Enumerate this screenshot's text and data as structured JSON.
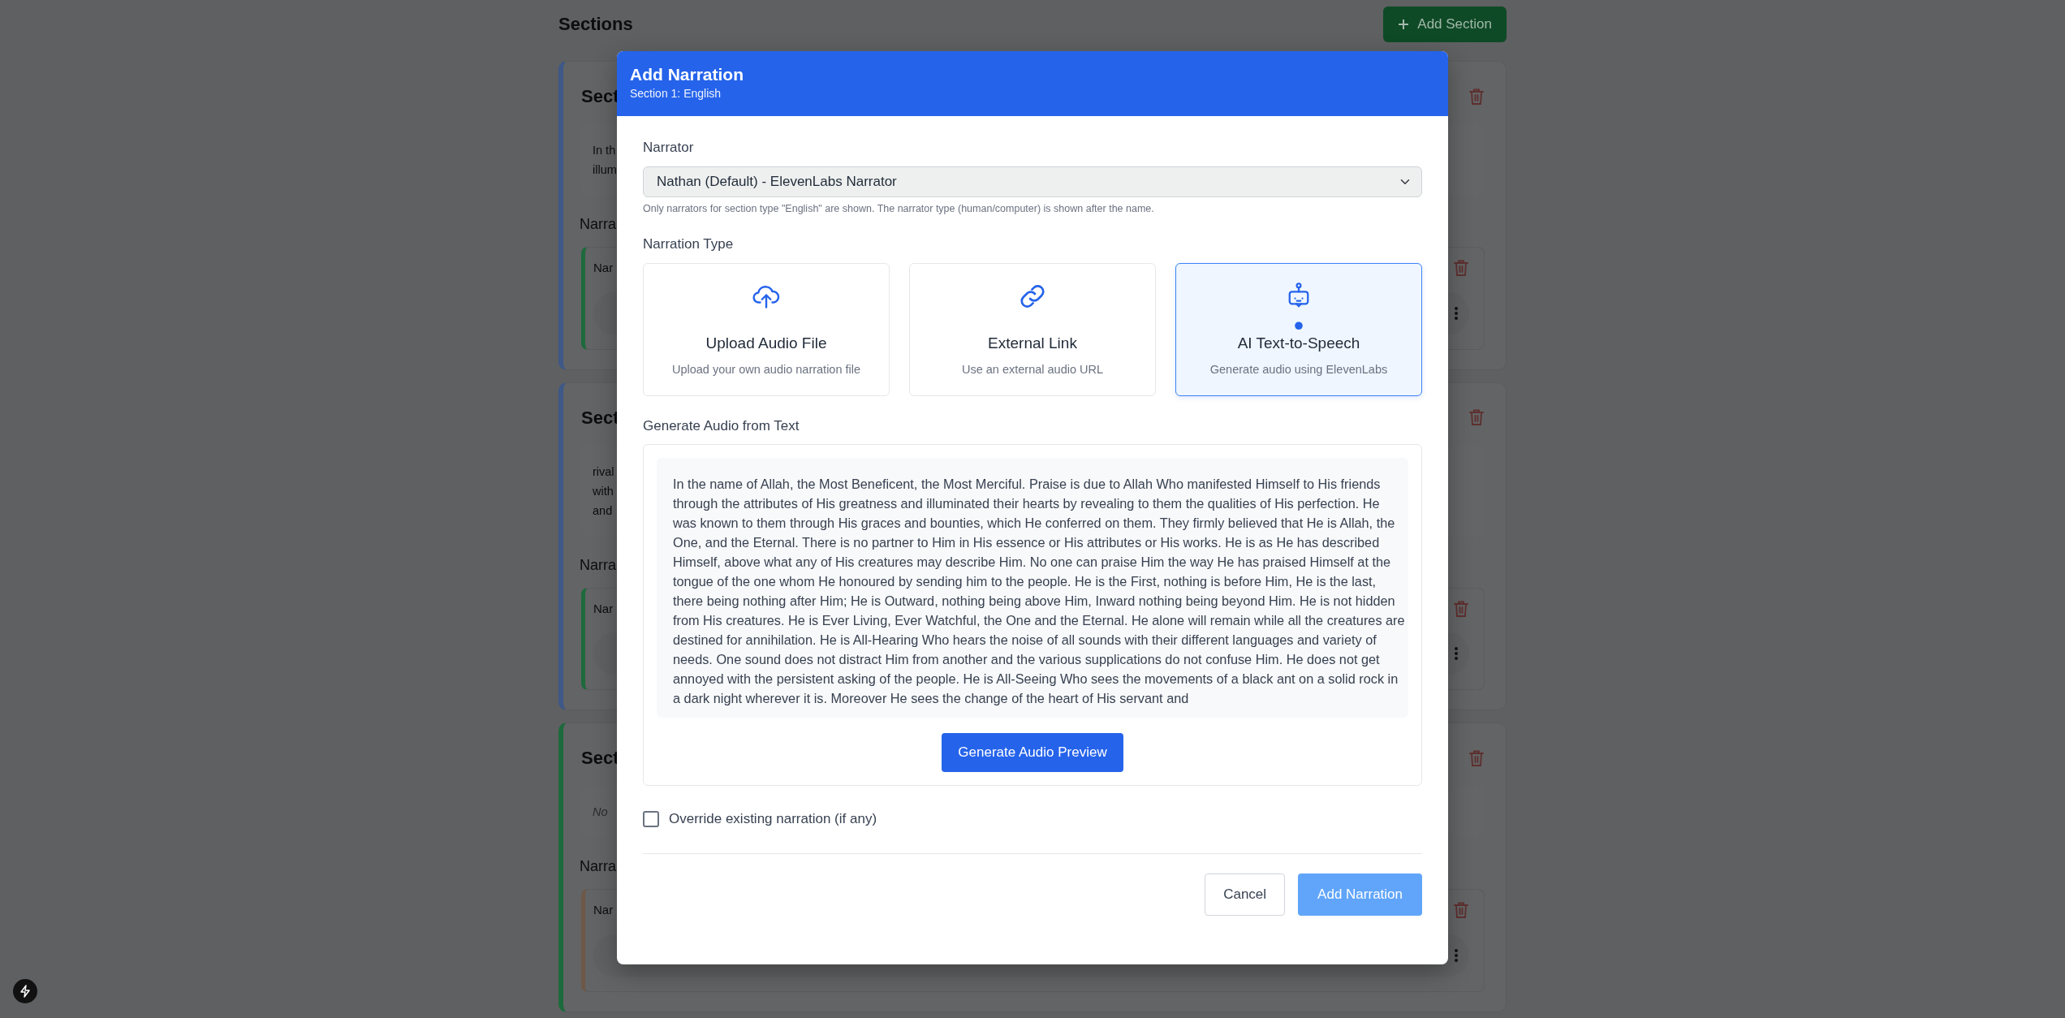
{
  "page": {
    "title": "Sections",
    "add_button": "Add Section"
  },
  "sections": [
    {
      "title": "Sect",
      "color": "#3e5887",
      "description": {
        "kind": "text",
        "lines": [
          "In th",
          "illum"
        ]
      },
      "narrations_label": "Narra",
      "narration": {
        "label": "Nar",
        "color": "#1d6a3c"
      }
    },
    {
      "title": "Sect",
      "color": "#3e5887",
      "description": {
        "kind": "text",
        "lines": [
          "rival",
          "with",
          "and"
        ]
      },
      "narrations_label": "Narra",
      "narration": {
        "label": "Nar",
        "color": "#1d6a3c"
      }
    },
    {
      "title": "Sect",
      "color": "#1d6a3c",
      "description": {
        "kind": "empty",
        "lines": [
          "No"
        ]
      },
      "narrations_label": "Narra",
      "narration": {
        "label": "Nar",
        "color": "#6e5848"
      }
    }
  ],
  "modal": {
    "title": "Add Narration",
    "subtitle": "Section 1: English",
    "narrator": {
      "label": "Narrator",
      "value": "Nathan (Default) - ElevenLabs Narrator",
      "help": "Only narrators for section type \"English\" are shown. The narrator type (human/computer) is shown after the name."
    },
    "narration_type": {
      "label": "Narration Type",
      "options": [
        {
          "kind": "upload",
          "title": "Upload Audio File",
          "description": "Upload your own audio narration file",
          "selected": false
        },
        {
          "kind": "link",
          "title": "External Link",
          "description": "Use an external audio URL",
          "selected": false
        },
        {
          "kind": "ai",
          "title": "AI Text-to-Speech",
          "description": "Generate audio using ElevenLabs",
          "selected": true
        }
      ]
    },
    "text_section": {
      "label": "Generate Audio from Text",
      "text": "In the name of Allah, the Most Beneficent, the Most Merciful. Praise is due to Allah Who manifested Himself to His friends through the attributes of His greatness and illuminated their hearts by revealing to them the qualities of His perfection. He was known to them through His graces and bounties, which He conferred on them. They firmly believed that He is Allah, the One, and the Eternal. There is no partner to Him in His essence or His attributes or His works. He is as He has described Himself, above what any of His creatures may describe Him. No one can praise Him the way He has praised Himself at the tongue of the one whom He honoured by sending him to the people. He is the First, nothing is before Him, He is the last, there being nothing after Him; He is Outward, nothing being above Him, Inward nothing being beyond Him. He is not hidden from His creatures. He is Ever Living, Ever Watchful, the One and the Eternal. He alone will remain while all the creatures are destined for annihilation. He is All-Hearing Who hears the noise of all sounds with their different languages and variety of needs. One sound does not distract Him from another and the various supplications do not confuse Him. He does not get annoyed with the persistent asking of the people. He is All-Seeing Who sees the movements of a black ant on a solid rock in a dark night wherever it is. Moreover He sees the change of the heart of His servant and",
      "button": "Generate Audio Preview"
    },
    "override": {
      "label": "Override existing narration (if any)",
      "checked": false
    },
    "buttons": {
      "cancel": "Cancel",
      "submit": "Add Narration",
      "submit_disabled": true
    }
  }
}
